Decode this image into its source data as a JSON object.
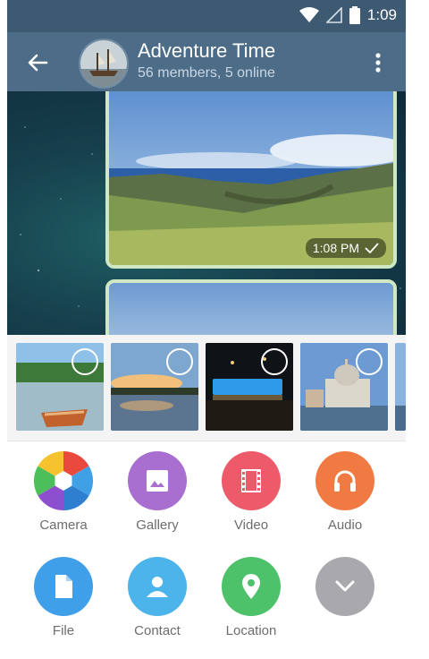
{
  "status_bar": {
    "time": "1:09"
  },
  "header": {
    "title": "Adventure Time",
    "subtitle": "56 members, 5 online",
    "icons": [
      "back-arrow-icon",
      "more-vertical-icon"
    ]
  },
  "chat": {
    "messages": [
      {
        "type": "photo",
        "time": "1:08 PM"
      },
      {
        "type": "photo"
      }
    ]
  },
  "attach_sheet": {
    "recent_photos": [
      {
        "name": "lake-boat"
      },
      {
        "name": "sunset-lake"
      },
      {
        "name": "pool-night"
      },
      {
        "name": "venice-church"
      }
    ],
    "options": [
      {
        "label": "Camera",
        "icon": "camera-aperture-icon",
        "color": "#f2f2f2"
      },
      {
        "label": "Gallery",
        "icon": "image-icon",
        "color": "#a86fd0"
      },
      {
        "label": "Video",
        "icon": "film-icon",
        "color": "#ed5b6a"
      },
      {
        "label": "Audio",
        "icon": "headphones-icon",
        "color": "#f17a43"
      },
      {
        "label": "File",
        "icon": "file-icon",
        "color": "#3f9fe8"
      },
      {
        "label": "Contact",
        "icon": "person-icon",
        "color": "#4cb4ea"
      },
      {
        "label": "Location",
        "icon": "location-pin-icon",
        "color": "#4ec26a"
      },
      {
        "label": "",
        "icon": "chevron-down-icon",
        "color": "#a9a9ad"
      }
    ]
  }
}
